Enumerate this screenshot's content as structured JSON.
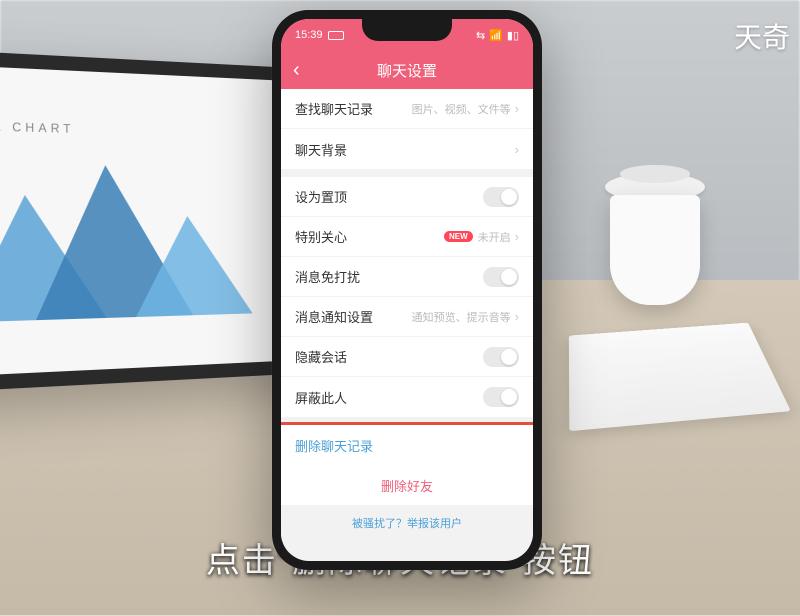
{
  "watermark": "天奇",
  "caption": "点击\"删除聊天记录\"按钮",
  "laptop_chart_title": "HILL CHART",
  "status": {
    "time": "15:39",
    "signals": "⬚ ⬚ ⬚"
  },
  "header": {
    "title": "聊天设置"
  },
  "rows": {
    "search_history": {
      "label": "查找聊天记录",
      "sub": "图片、视频、文件等"
    },
    "background": {
      "label": "聊天背景"
    },
    "pin": {
      "label": "设为置顶"
    },
    "special_care": {
      "label": "特别关心",
      "badge": "NEW",
      "sub": "未开启"
    },
    "dnd": {
      "label": "消息免打扰"
    },
    "notification": {
      "label": "消息通知设置",
      "sub": "通知预览、提示音等"
    },
    "hide": {
      "label": "隐藏会话"
    },
    "block": {
      "label": "屏蔽此人"
    },
    "delete_history": {
      "label": "删除聊天记录"
    },
    "delete_friend": {
      "label": "删除好友"
    },
    "report": {
      "label": "被骚扰了？举报该用户"
    }
  }
}
